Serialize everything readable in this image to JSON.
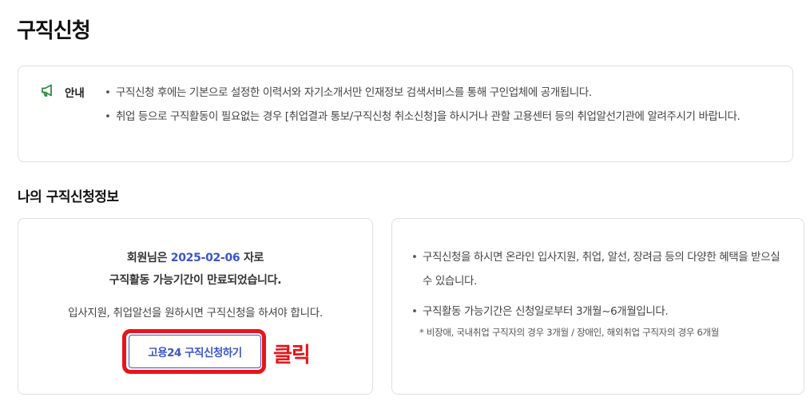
{
  "page": {
    "title": "구직신청"
  },
  "notice": {
    "label": "안내",
    "items": [
      "구직신청 후에는 기본으로 설정한 이력서와 자기소개서만 인재정보 검색서비스를 통해 구인업체에 공개됩니다.",
      "취업 등으로 구직활동이 필요없는 경우 [취업결과 통보/구직신청 취소신청]을 하시거나 관할 고용센터 등의 취업알선기관에 알려주시기 바랍니다."
    ]
  },
  "section": {
    "title": "나의 구직신청정보"
  },
  "status": {
    "prefix": "회원님은",
    "date": "2025-02-06",
    "suffix": "자로",
    "expired": "구직활동 가능기간이 만료되었습니다.",
    "guide": "입사지원, 취업알선을 원하시면 구직신청을 하셔야 합니다.",
    "apply_button": "고용24 구직신청하기"
  },
  "annotation": {
    "click_label": "클릭",
    "highlight_color": "#e8141a"
  },
  "info": {
    "items": [
      "구직신청을 하시면 온라인 입사지원, 취업, 알선, 장려금 등의 다양한 혜택을 받으실 수 있습니다.",
      "구직활동 가능기간은 신청일로부터 3개월~6개월입니다."
    ],
    "note": "* 비장애, 국내취업 구직자의 경우 3개월 / 장애인, 해외취업 구직자의 경우 6개월"
  },
  "colors": {
    "accent": "#3b55c7",
    "icon_green": "#2e8b3e",
    "border": "#dcdfe4"
  },
  "icons": {
    "notice": "megaphone-icon"
  }
}
